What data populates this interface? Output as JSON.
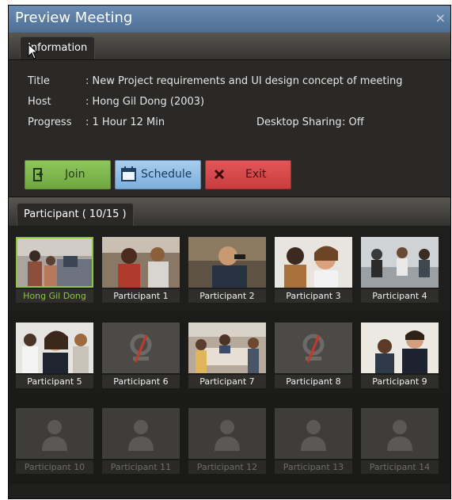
{
  "window": {
    "title": "Preview Meeting",
    "close_glyph": "×"
  },
  "info_tab": {
    "label": "Information"
  },
  "info": {
    "title_label": "Title",
    "title_value": ": New Project requirements and UI design concept of meeting",
    "host_label": "Host",
    "host_value": ": Hong Gil Dong (2003)",
    "progress_label": "Progress",
    "progress_value": ": 1 Hour 12 Min",
    "sharing_label": "Desktop Sharing",
    "sharing_value": ": Off"
  },
  "buttons": {
    "join": "Join",
    "schedule": "Schedule",
    "exit": "Exit"
  },
  "participant_tab": {
    "label": "Participant ( 10/15 )"
  },
  "participants": [
    {
      "name": "Hong Gil Dong",
      "state": "video",
      "selected": true
    },
    {
      "name": "Participant 1",
      "state": "video"
    },
    {
      "name": "Participant 2",
      "state": "video"
    },
    {
      "name": "Participant 3",
      "state": "video"
    },
    {
      "name": "Participant 4",
      "state": "video"
    },
    {
      "name": "Participant 5",
      "state": "video"
    },
    {
      "name": "Participant 6",
      "state": "camera-off"
    },
    {
      "name": "Participant 7",
      "state": "video"
    },
    {
      "name": "Participant 8",
      "state": "camera-off"
    },
    {
      "name": "Participant 9",
      "state": "video"
    },
    {
      "name": "Participant 10",
      "state": "offline"
    },
    {
      "name": "Participant 11",
      "state": "offline"
    },
    {
      "name": "Participant 12",
      "state": "offline"
    },
    {
      "name": "Participant 13",
      "state": "offline"
    },
    {
      "name": "Participant 14",
      "state": "offline"
    }
  ],
  "colors": {
    "accent_green": "#8dc63f",
    "title_blue": "#5a7ca3",
    "join_green": "#7db84a",
    "schedule_blue": "#8fbbe4",
    "exit_red": "#d6484b"
  },
  "icons": {
    "close": "close-icon",
    "join": "join-icon",
    "schedule": "calendar-icon",
    "exit": "x-icon",
    "camera_off": "camera-off-icon",
    "person": "person-silhouette-icon"
  }
}
